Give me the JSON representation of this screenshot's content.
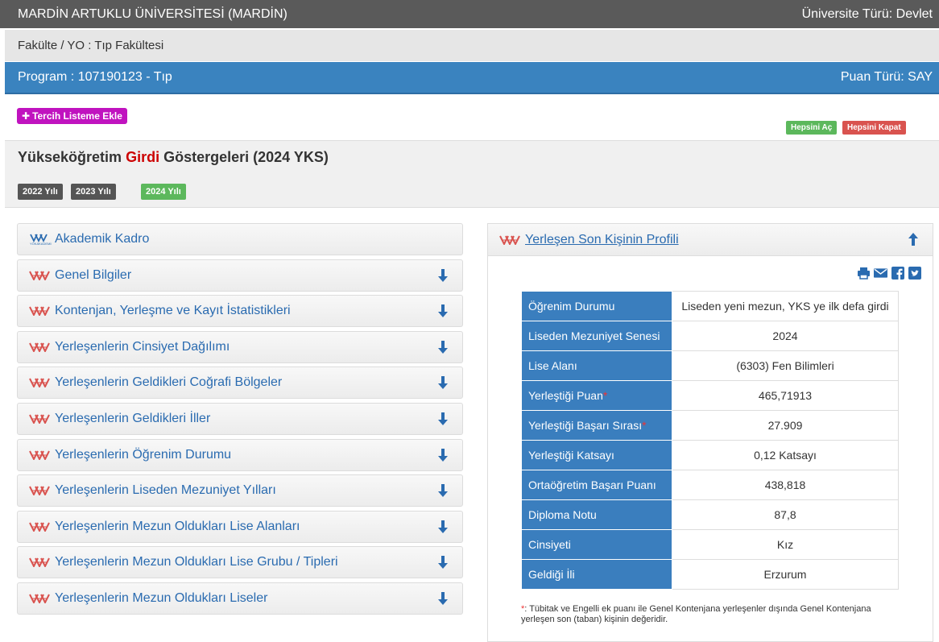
{
  "header": {
    "university": "MARDİN ARTUKLU ÜNİVERSİTESİ (MARDİN)",
    "university_type": "Üniversite Türü: Devlet",
    "faculty": "Fakülte / YO : Tıp Fakültesi",
    "program": "Program : 107190123 - Tıp",
    "score_type": "Puan Türü: SAY"
  },
  "actions": {
    "add_to_list": "Tercih Listeme Ekle",
    "open_all": "Hepsini Aç",
    "close_all": "Hepsini Kapat"
  },
  "section": {
    "title_pre": "Yükseköğretim ",
    "title_red": "Girdi",
    "title_post": " Göstergeleri (2024 YKS)",
    "years": [
      "2022 Yılı",
      "2023 Yılı",
      "2024 Yılı"
    ]
  },
  "accordion": [
    {
      "label": "Akademik Kadro"
    },
    {
      "label": "Genel Bilgiler"
    },
    {
      "label": "Kontenjan, Yerleşme ve Kayıt İstatistikleri"
    },
    {
      "label": "Yerleşenlerin Cinsiyet Dağılımı"
    },
    {
      "label": "Yerleşenlerin Geldikleri Coğrafi Bölgeler"
    },
    {
      "label": "Yerleşenlerin Geldikleri İller"
    },
    {
      "label": "Yerleşenlerin Öğrenim Durumu"
    },
    {
      "label": "Yerleşenlerin Liseden Mezuniyet Yılları"
    },
    {
      "label": "Yerleşenlerin Mezun Oldukları Lise Alanları"
    },
    {
      "label": "Yerleşenlerin Mezun Oldukları Lise Grubu / Tipleri"
    },
    {
      "label": "Yerleşenlerin Mezun Oldukları Liseler"
    }
  ],
  "profile": {
    "title": "Yerleşen Son Kişinin Profili",
    "rows": [
      {
        "key": "Öğrenim Durumu",
        "value": "Liseden yeni mezun, YKS ye ilk defa girdi",
        "star": ""
      },
      {
        "key": "Liseden Mezuniyet Senesi",
        "value": "2024",
        "star": ""
      },
      {
        "key": "Lise Alanı",
        "value": "(6303) Fen Bilimleri",
        "star": ""
      },
      {
        "key": "Yerleştiği Puan",
        "value": "465,71913",
        "star": "*"
      },
      {
        "key": "Yerleştiği Başarı Sırası",
        "value": "27.909",
        "star": "*"
      },
      {
        "key": "Yerleştiği Katsayı",
        "value": "0,12 Katsayı",
        "star": ""
      },
      {
        "key": "Ortaöğretim Başarı Puanı",
        "value": "438,818",
        "star": ""
      },
      {
        "key": "Diploma Notu",
        "value": "87,8",
        "star": ""
      },
      {
        "key": "Cinsiyeti",
        "value": "Kız",
        "star": ""
      },
      {
        "key": "Geldiği İli",
        "value": "Erzurum",
        "star": ""
      }
    ],
    "note_star": "*",
    "note": ": Tübitak ve Engelli ek puanı ile Genel Kontenjana yerleşenler dışında Genel Kontenjana yerleşen son (taban) kişinin değeridir."
  },
  "colors": {
    "program_bar": "#3a83bf",
    "add_button": "#c013bf",
    "link": "#2a6bb0",
    "table_key": "#3a7ebe"
  }
}
